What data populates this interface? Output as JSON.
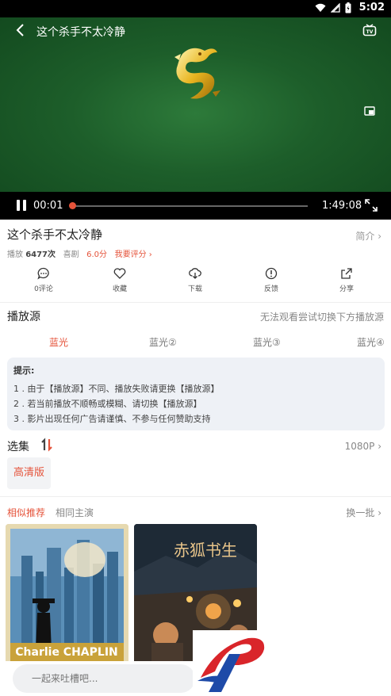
{
  "status_bar": {
    "time": "5:02"
  },
  "player": {
    "title": "这个杀手不太冷静",
    "current_time": "00:01",
    "total_time": "1:49:08",
    "progress": 0.001
  },
  "info": {
    "title": "这个杀手不太冷静",
    "intro_label": "简介 ›",
    "plays_label": "播放",
    "plays_value": "6477次",
    "genre": "喜剧",
    "score": "6.0分",
    "rate_label": "我要评分 ›"
  },
  "actions": [
    {
      "icon": "comment-icon",
      "label": "0评论"
    },
    {
      "icon": "heart-icon",
      "label": "收藏"
    },
    {
      "icon": "download-icon",
      "label": "下载"
    },
    {
      "icon": "feedback-icon",
      "label": "反馈"
    },
    {
      "icon": "share-icon",
      "label": "分享"
    }
  ],
  "source": {
    "title": "播放源",
    "hint": "无法观看尝试切换下方播放源",
    "tabs": [
      "蓝光",
      "蓝光②",
      "蓝光③",
      "蓝光④"
    ]
  },
  "tips": {
    "heading": "提示:",
    "lines": [
      "1 . 由于【播放源】不同、播放失败请更换【播放源】",
      "2 . 若当前播放不顺畅或模糊、请切换【播放源】",
      "3 . 影片出现任何广告请谨慎、不参与任何赞助支持"
    ]
  },
  "episodes": {
    "title": "选集",
    "quality": "1080P ›",
    "items": [
      "高清版"
    ]
  },
  "recommend": {
    "tab_similar": "相似推荐",
    "tab_same_actor": "相同主演",
    "refresh": "换一批 ›",
    "poster1_text": "Charlie CHAPLIN",
    "poster2_text": "赤狐书生"
  },
  "comment_box": {
    "placeholder": "一起来吐槽吧..."
  },
  "colors": {
    "accent": "#e5533a",
    "video_green": "#1d5e2a"
  }
}
